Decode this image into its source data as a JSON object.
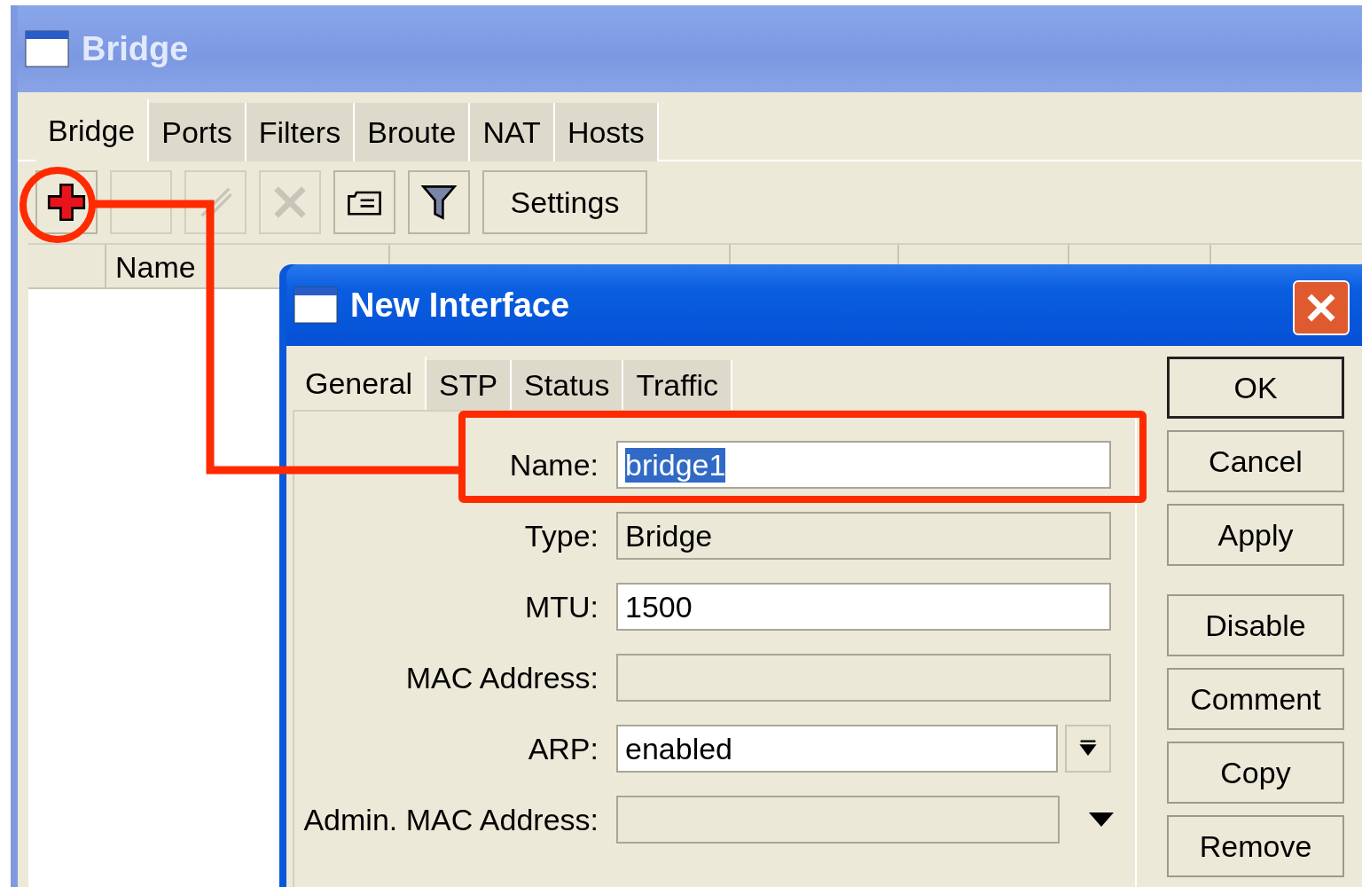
{
  "window": {
    "title": "Bridge"
  },
  "tabs": [
    {
      "label": "Bridge",
      "selected": true
    },
    {
      "label": "Ports",
      "selected": false
    },
    {
      "label": "Filters",
      "selected": false
    },
    {
      "label": "Broute",
      "selected": false
    },
    {
      "label": "NAT",
      "selected": false
    },
    {
      "label": "Hosts",
      "selected": false
    }
  ],
  "toolbar": {
    "buttons": [
      {
        "kind": "add",
        "disabled": false
      },
      {
        "kind": "remove",
        "disabled": true
      },
      {
        "kind": "enable",
        "disabled": true
      },
      {
        "kind": "disable",
        "disabled": true
      },
      {
        "kind": "comment",
        "disabled": false
      },
      {
        "kind": "filter",
        "disabled": false
      }
    ],
    "settings": "Settings"
  },
  "table": {
    "columns": [
      "Name"
    ]
  },
  "dialog": {
    "title": "New Interface",
    "tabs": [
      {
        "label": "General",
        "selected": true
      },
      {
        "label": "STP",
        "selected": false
      },
      {
        "label": "Status",
        "selected": false
      },
      {
        "label": "Traffic",
        "selected": false
      }
    ],
    "fields": [
      {
        "label": "Name:",
        "value": "bridge1",
        "kind": "text",
        "highlighted": true
      },
      {
        "label": "Type:",
        "value": "Bridge",
        "kind": "readonly"
      },
      {
        "label": "MTU:",
        "value": "1500",
        "kind": "text"
      },
      {
        "label": "MAC Address:",
        "kind": "readonly"
      },
      {
        "label": "ARP:",
        "value": "enabled",
        "kind": "select"
      },
      {
        "label": "Admin. MAC Address:",
        "kind": "combo"
      }
    ],
    "button_groups": [
      [
        {
          "label": "OK",
          "default": true
        },
        {
          "label": "Cancel",
          "default": false
        },
        {
          "label": "Apply",
          "default": false
        }
      ],
      [
        {
          "label": "Disable",
          "default": false
        },
        {
          "label": "Comment",
          "default": false
        },
        {
          "label": "Copy",
          "default": false
        },
        {
          "label": "Remove",
          "default": false
        }
      ]
    ]
  }
}
